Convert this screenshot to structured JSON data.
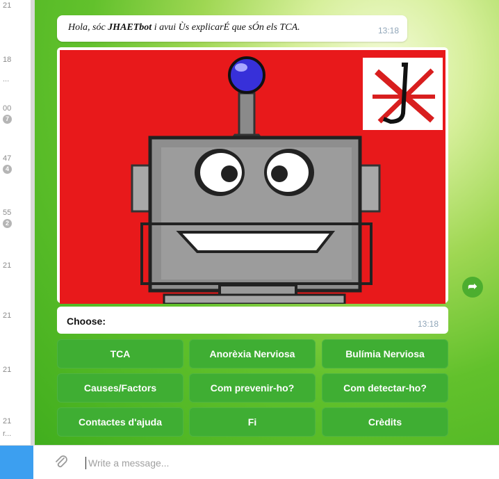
{
  "chat_list": {
    "items": [
      {
        "time": "21",
        "badge": ""
      },
      {
        "time": "18",
        "badge": ""
      },
      {
        "time": "...",
        "badge": ""
      },
      {
        "time": "00",
        "badge": "7"
      },
      {
        "time": "47",
        "badge": "4"
      },
      {
        "time": "55",
        "badge": "2"
      },
      {
        "time": "21",
        "badge": ""
      },
      {
        "time": "21",
        "badge": ""
      },
      {
        "time": "21",
        "badge": ""
      },
      {
        "time": "21",
        "badge": ""
      },
      {
        "time": "r...",
        "badge": ""
      }
    ]
  },
  "messages": {
    "greeting": {
      "prefix": "Hola, sóc ",
      "bot_name": "JHAETbot",
      "suffix": " i avui Ùs explicarÉ que sÓn els TCA.",
      "time": "13:18"
    },
    "choose": {
      "label": "Choose:",
      "time": "13:18"
    }
  },
  "keyboard": {
    "row1": [
      "TCA",
      "Anorèxia Nerviosa",
      "Bulímia Nerviosa"
    ],
    "row2": [
      "Causes/Factors",
      "Com prevenir-ho?",
      "Com detectar-ho?"
    ],
    "row3": [
      "Contactes d'ajuda",
      "Fi",
      "Crèdits"
    ]
  },
  "input": {
    "placeholder": "Write a message..."
  },
  "icons": {
    "forward": "share-forward-icon",
    "attach": "paperclip-icon"
  },
  "colors": {
    "keyboard_button": "#3fae33",
    "image_background": "#e8191b",
    "input_accent": "#3c9ff0"
  }
}
